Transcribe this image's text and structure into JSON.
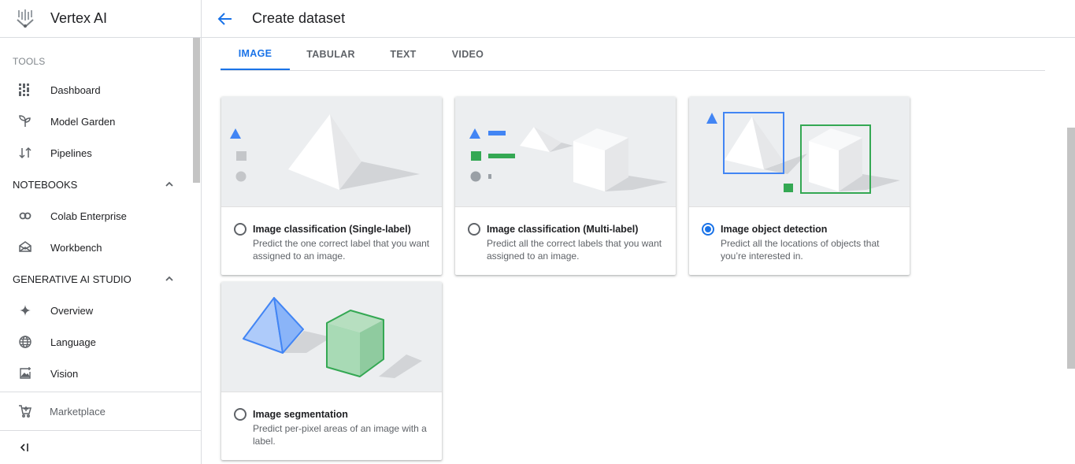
{
  "app": {
    "title": "Vertex AI"
  },
  "sidebar": {
    "tools_label": "TOOLS",
    "tools": [
      {
        "label": "Dashboard",
        "icon": "dashboard-icon"
      },
      {
        "label": "Model Garden",
        "icon": "model-garden-icon"
      },
      {
        "label": "Pipelines",
        "icon": "pipelines-icon"
      }
    ],
    "notebooks_label": "NOTEBOOKS",
    "notebooks": [
      {
        "label": "Colab Enterprise",
        "icon": "colab-icon"
      },
      {
        "label": "Workbench",
        "icon": "workbench-icon"
      }
    ],
    "genai_label": "GENERATIVE AI STUDIO",
    "genai": [
      {
        "label": "Overview",
        "icon": "sparkle-icon"
      },
      {
        "label": "Language",
        "icon": "language-icon"
      },
      {
        "label": "Vision",
        "icon": "vision-icon"
      }
    ],
    "marketplace_label": "Marketplace"
  },
  "header": {
    "title": "Create dataset"
  },
  "tabs": [
    {
      "label": "IMAGE",
      "active": true
    },
    {
      "label": "TABULAR",
      "active": false
    },
    {
      "label": "TEXT",
      "active": false
    },
    {
      "label": "VIDEO",
      "active": false
    }
  ],
  "options": [
    {
      "title": "Image classification (Single-label)",
      "desc": "Predict the one correct label that you want assigned to an image.",
      "selected": false
    },
    {
      "title": "Image classification (Multi-label)",
      "desc": "Predict all the correct labels that you want assigned to an image.",
      "selected": false
    },
    {
      "title": "Image object detection",
      "desc": "Predict all the locations of objects that you’re interested in.",
      "selected": true
    },
    {
      "title": "Image segmentation",
      "desc": "Predict per-pixel areas of an image with a label.",
      "selected": false
    }
  ],
  "colors": {
    "accent": "#1a73e8",
    "blue_shape": "#4285f4",
    "green_shape": "#34a853",
    "illustration_bg": "#eceef0"
  }
}
